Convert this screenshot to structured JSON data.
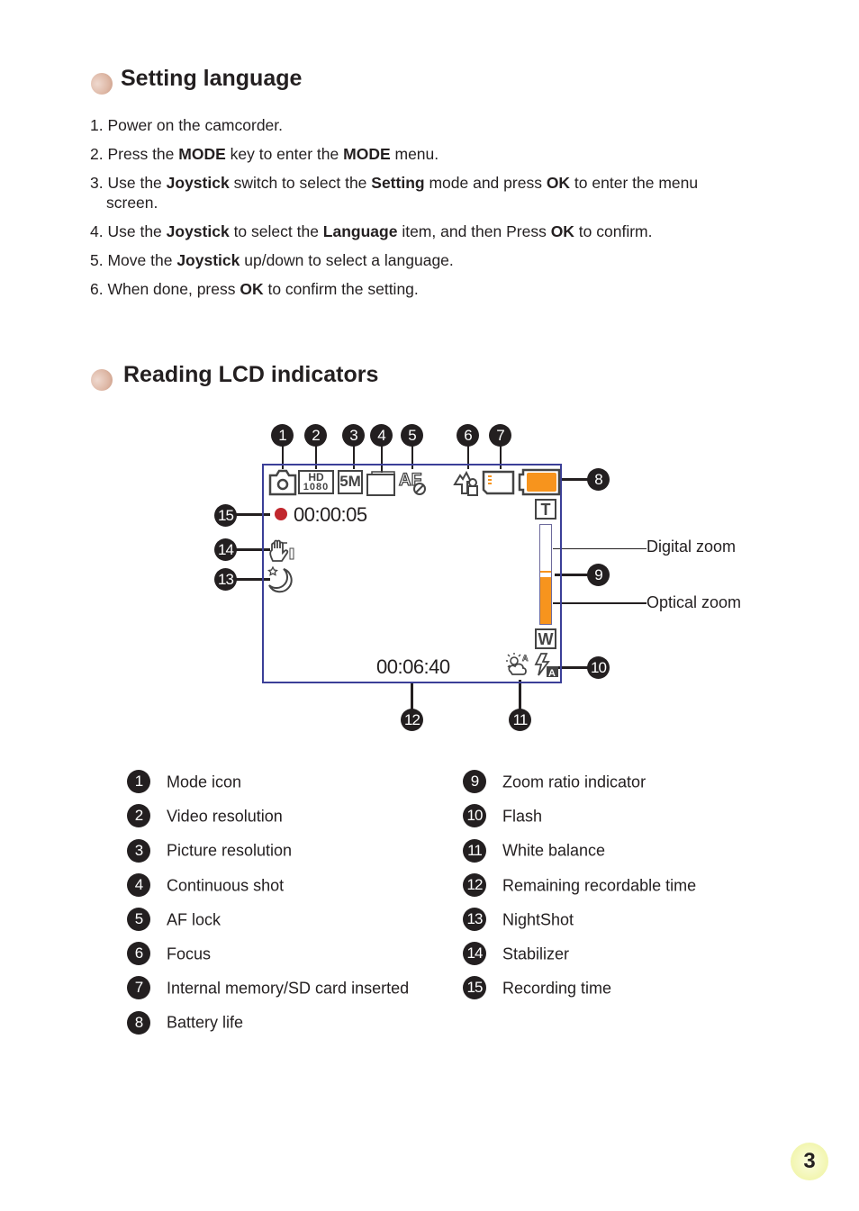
{
  "section1": {
    "title": "Setting language",
    "steps": [
      {
        "n": "1. ",
        "parts": [
          {
            "t": "Power on the camcorder."
          }
        ]
      },
      {
        "n": "2. ",
        "parts": [
          {
            "t": "Press the "
          },
          {
            "b": "MODE"
          },
          {
            "t": " key to enter the "
          },
          {
            "b": "MODE"
          },
          {
            "t": " menu."
          }
        ]
      },
      {
        "n": "3. ",
        "parts": [
          {
            "t": "Use the "
          },
          {
            "b": "Joystick"
          },
          {
            "t": " switch to select the "
          },
          {
            "b": "Setting"
          },
          {
            "t": " mode and press "
          },
          {
            "b": "OK"
          },
          {
            "t": " to enter the menu"
          }
        ],
        "cont": "screen."
      },
      {
        "n": "4. ",
        "parts": [
          {
            "t": "Use the "
          },
          {
            "b": "Joystick"
          },
          {
            "t": " to select the "
          },
          {
            "b": "Language"
          },
          {
            "t": " item, and then Press "
          },
          {
            "b": "OK"
          },
          {
            "t": " to confirm."
          }
        ]
      },
      {
        "n": "5. ",
        "parts": [
          {
            "t": "Move the "
          },
          {
            "b": "Joystick"
          },
          {
            "t": " up/down to select a language."
          }
        ]
      },
      {
        "n": "6. ",
        "parts": [
          {
            "t": "When done, press "
          },
          {
            "b": "OK"
          },
          {
            "t": " to confirm the setting."
          }
        ]
      }
    ]
  },
  "section2": {
    "title": "Reading LCD indicators",
    "lcd": {
      "recording_time": "00:00:05",
      "remaining_time": "00:06:40",
      "video_res_top": "HD",
      "video_res_bottom": "1080",
      "picture_res": "5M",
      "zoom_tele": "T",
      "zoom_wide": "W",
      "optical_zoom_fraction": 0.48,
      "battery_color": "#f7941d",
      "record_dot_color": "#c1272d",
      "frame_color": "#3b3f98"
    },
    "callouts": [
      "1",
      "2",
      "3",
      "4",
      "5",
      "6",
      "7",
      "8",
      "9",
      "10",
      "11",
      "12",
      "13",
      "14",
      "15"
    ],
    "zoom_labels": {
      "digital": "Digital zoom",
      "optical": "Optical zoom"
    },
    "legend_left": [
      {
        "n": "1",
        "label": "Mode icon"
      },
      {
        "n": "2",
        "label": "Video resolution"
      },
      {
        "n": "3",
        "label": "Picture resolution"
      },
      {
        "n": "4",
        "label": "Continuous shot"
      },
      {
        "n": "5",
        "label": "AF lock"
      },
      {
        "n": "6",
        "label": "Focus"
      },
      {
        "n": "7",
        "label": "Internal memory/SD card inserted"
      },
      {
        "n": "8",
        "label": "Battery life"
      }
    ],
    "legend_right": [
      {
        "n": "9",
        "label": "Zoom ratio indicator"
      },
      {
        "n": "10",
        "label": "Flash"
      },
      {
        "n": "11",
        "label": "White balance"
      },
      {
        "n": "12",
        "label": "Remaining recordable time"
      },
      {
        "n": "13",
        "label": "NightShot"
      },
      {
        "n": "14",
        "label": "Stabilizer"
      },
      {
        "n": "15",
        "label": "Recording time"
      }
    ]
  },
  "page_number": "3"
}
